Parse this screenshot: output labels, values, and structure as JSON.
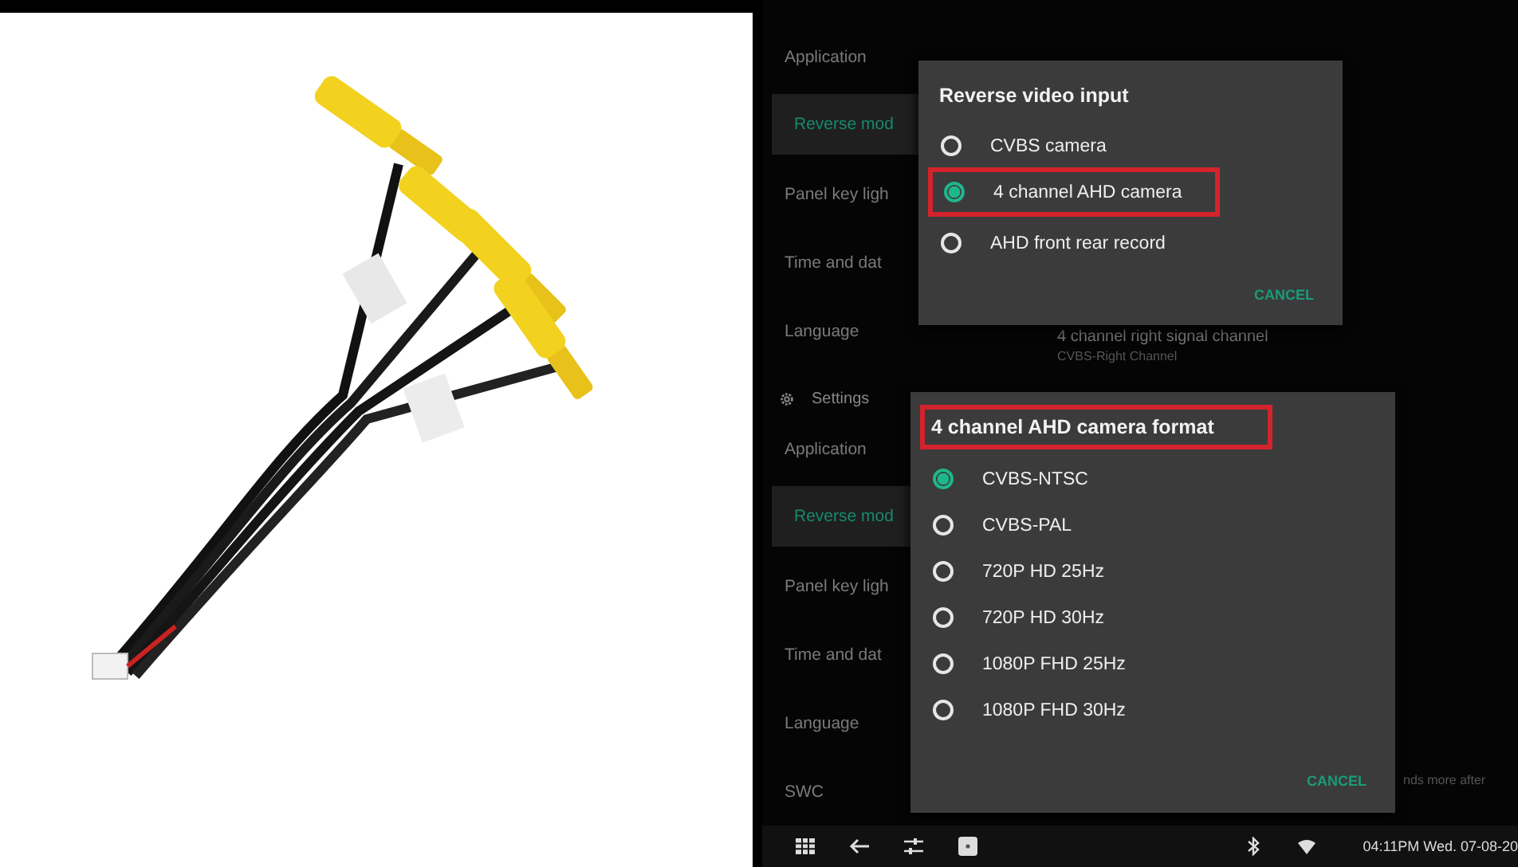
{
  "screens": [
    {
      "sidebar": [
        {
          "label": "Application",
          "selected": false
        },
        {
          "label": "Reverse mod",
          "selected": true
        },
        {
          "label": "Panel key ligh",
          "selected": false
        },
        {
          "label": "Time and dat",
          "selected": false
        },
        {
          "label": "Language",
          "selected": false
        }
      ],
      "detail": {
        "title": "4 channel right signal channel",
        "subtitle": "CVBS-Right Channel"
      },
      "dialog": {
        "title": "Reverse video input",
        "title_highlighted": false,
        "cancel": "CANCEL",
        "options": [
          {
            "label": "CVBS camera",
            "selected": false,
            "highlighted": false
          },
          {
            "label": "4 channel AHD camera",
            "selected": true,
            "highlighted": true
          },
          {
            "label": "AHD front rear record",
            "selected": false,
            "highlighted": false
          }
        ]
      }
    },
    {
      "header": "Settings",
      "sidebar": [
        {
          "label": "Application",
          "selected": false
        },
        {
          "label": "Reverse mod",
          "selected": true
        },
        {
          "label": "Panel key ligh",
          "selected": false
        },
        {
          "label": "Time and dat",
          "selected": false
        },
        {
          "label": "Language",
          "selected": false
        },
        {
          "label": "SWC",
          "selected": false
        }
      ],
      "fragment": "nds more after",
      "dialog": {
        "title": "4 channel AHD camera format",
        "title_highlighted": true,
        "cancel": "CANCEL",
        "options": [
          {
            "label": "CVBS-NTSC",
            "selected": true,
            "highlighted": false
          },
          {
            "label": "CVBS-PAL",
            "selected": false,
            "highlighted": false
          },
          {
            "label": "720P HD 25Hz",
            "selected": false,
            "highlighted": false
          },
          {
            "label": "720P HD 30Hz",
            "selected": false,
            "highlighted": false
          },
          {
            "label": "1080P FHD 25Hz",
            "selected": false,
            "highlighted": false
          },
          {
            "label": "1080P FHD 30Hz",
            "selected": false,
            "highlighted": false
          }
        ]
      }
    }
  ],
  "navbar": {
    "clock": "04:11PM Wed. 07-08-20"
  }
}
